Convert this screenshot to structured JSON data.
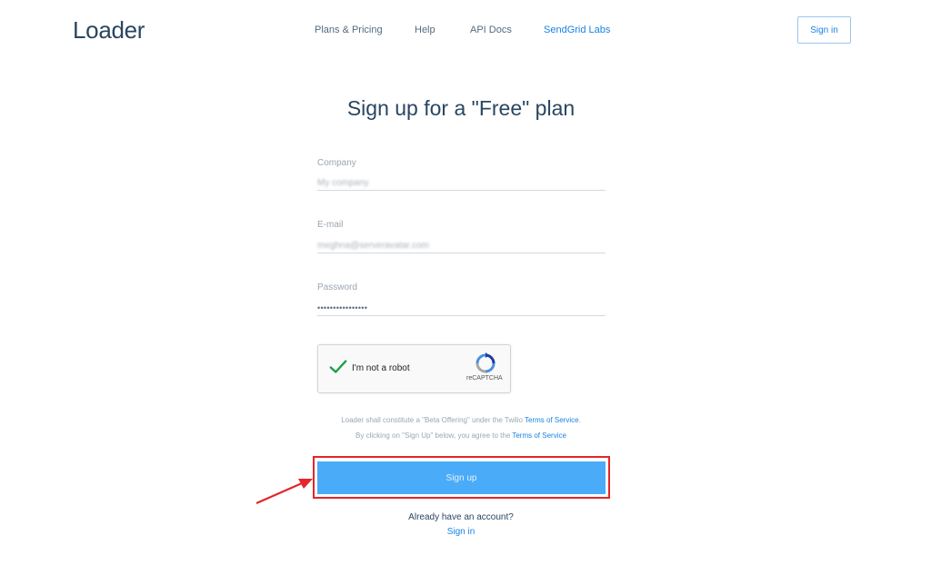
{
  "header": {
    "logo": "Loader",
    "nav": [
      "Plans & Pricing",
      "Help",
      "API Docs",
      "SendGrid Labs"
    ],
    "signin_label": "Sign in"
  },
  "form": {
    "title": "Sign up for a \"Free\" plan",
    "company": {
      "label": "Company",
      "value": "My company"
    },
    "email": {
      "label": "E-mail",
      "value": "meghna@serveravatar.com"
    },
    "password": {
      "label": "Password",
      "value": "••••••••••••••••"
    },
    "captcha": {
      "label": "I'm not a robot",
      "brand": "reCAPTCHA"
    },
    "terms_line1_prefix": "Loader shall constitute a \"Beta Offering\" under the Twilio ",
    "terms_line1_link": "Terms of Service",
    "terms_line1_suffix": ".",
    "terms_line2_prefix": "By clicking on \"Sign Up\" below, you agree to the ",
    "terms_line2_link": "Terms of Service",
    "signup_label": "Sign up",
    "already_text": "Already have an account?",
    "signin_link": "Sign in"
  },
  "colors": {
    "brand_navy": "#294661",
    "link_blue": "#1a82e2",
    "button_blue": "#4aabf8",
    "highlight_red": "#e3262a"
  }
}
